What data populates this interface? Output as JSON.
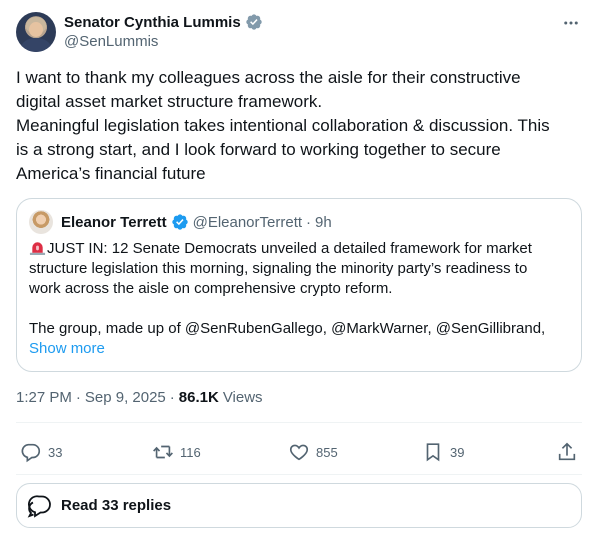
{
  "author": {
    "name": "Senator Cynthia Lummis",
    "handle": "@SenLummis",
    "verified_icon": "verified-government-gray-badge",
    "more_icon": "more-horizontal-icon"
  },
  "tweet": {
    "lines": [
      "I want to thank my colleagues across the aisle for their constructive",
      "digital asset market structure framework.",
      "Meaningful legislation takes intentional collaboration & discussion. This",
      "is a strong start, and I look forward to working together to secure",
      "America’s financial future"
    ]
  },
  "quote": {
    "name": "Eleanor Terrett",
    "handle": "@EleanorTerrett",
    "separator": "·",
    "time": "9h",
    "verified_icon": "verified-blue-badge",
    "emoji_icon": "rotating-light-siren-icon",
    "lines": [
      "JUST IN: 12 Senate Democrats unveiled a detailed framework for market",
      "structure legislation this morning, signaling the minority party’s readiness to",
      "work across the aisle on comprehensive crypto reform."
    ],
    "lines2": [
      "The group, made up of @SenRubenGallego, @MarkWarner, @SenGillibrand,"
    ],
    "show_more": "Show more"
  },
  "meta": {
    "time": "1:27 PM",
    "separator": "·",
    "date": "Sep 9, 2025",
    "separator2": "·",
    "views_count": "86.1K",
    "views_label": "Views"
  },
  "actions": {
    "replies": "33",
    "reposts": "116",
    "likes": "855",
    "bookmarks": "39"
  },
  "read_replies": {
    "label": "Read 33 replies"
  },
  "colors": {
    "text": "#0f1419",
    "secondary": "#536471",
    "link": "#1d9bf0",
    "border": "#cfd9de"
  }
}
